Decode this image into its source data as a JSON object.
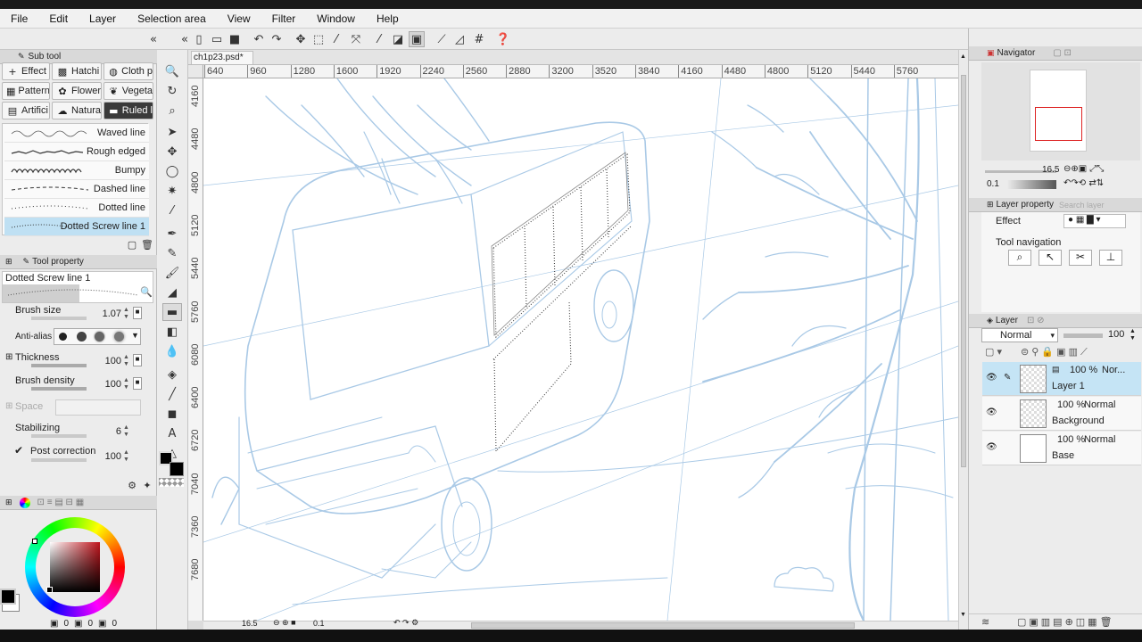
{
  "menu": [
    "File",
    "Edit",
    "Layer",
    "Selection area",
    "View",
    "Filter",
    "Window",
    "Help"
  ],
  "sub_tool": {
    "title": "Sub tool",
    "tabs": [
      {
        "label": "Effect",
        "icon": "plus-icon"
      },
      {
        "label": "Hatchi",
        "icon": "hatching-icon"
      },
      {
        "label": "Cloth p",
        "icon": "cloth-icon"
      },
      {
        "label": "Pattern",
        "icon": "pattern-icon"
      },
      {
        "label": "Flower",
        "icon": "flower-icon"
      },
      {
        "label": "Vegeta",
        "icon": "vegetation-icon"
      },
      {
        "label": "Artifici",
        "icon": "artificial-icon"
      },
      {
        "label": "Natura",
        "icon": "nature-icon"
      },
      {
        "label": "Ruled l",
        "icon": "ruled-line-icon"
      }
    ],
    "brushes": [
      "Waved line",
      "Rough edged",
      "Bumpy",
      "Dashed line",
      "Dotted line",
      "Dotted Screw line 1"
    ],
    "selected_brush": "Dotted Screw line 1"
  },
  "tool_property": {
    "title": "Tool property",
    "brush_name": "Dotted Screw line 1",
    "brush_size_label": "Brush size",
    "brush_size": "1.07",
    "anti_alias_label": "Anti-alias",
    "thickness_label": "Thickness",
    "thickness": "100",
    "brush_density_label": "Brush density",
    "brush_density": "100",
    "space_label": "Space",
    "stabilizing_label": "Stabilizing",
    "stabilizing": "6",
    "post_correction_label": "Post correction",
    "post_correction": "100"
  },
  "color": {
    "main_color": "#000000",
    "sub_color": "#ffffff",
    "hue_base": "#c0141c",
    "counts": [
      "0",
      "0",
      "0"
    ]
  },
  "document": {
    "tab_label": "ch1p23.psd*",
    "h_ruler": [
      "640",
      "960",
      "1280",
      "1600",
      "1920",
      "2240",
      "2560",
      "2880",
      "3200",
      "3520",
      "3840",
      "4160",
      "4480",
      "4800",
      "5120",
      "5440",
      "5760"
    ],
    "v_ruler": [
      "4160",
      "4480",
      "4800",
      "5120",
      "5440",
      "5760",
      "6080",
      "6400",
      "6720",
      "7040",
      "7360",
      "7680"
    ],
    "status_zoom": "16.5",
    "status_angle": "0.1"
  },
  "navigator": {
    "title": "Navigator",
    "zoom": "16.5",
    "angle": "0.1"
  },
  "layer_property": {
    "title": "Layer property",
    "effect_label": "Effect",
    "tool_navigation_label": "Tool navigation",
    "search_label": "Search layer"
  },
  "layer_panel": {
    "title": "Layer",
    "blend_mode": "Normal",
    "opacity": "100",
    "layers": [
      {
        "name": "Layer 1",
        "opacity": "100 %",
        "mode": "Nor...",
        "selected": true
      },
      {
        "name": "Background",
        "opacity": "100 %",
        "mode": "Normal",
        "selected": false
      },
      {
        "name": "Base",
        "opacity": "100 %",
        "mode": "Normal",
        "selected": false
      }
    ]
  },
  "colors": {
    "sketch_blue": "#a9c9e6",
    "selection_blue": "#bfe0f3",
    "panel_bg": "#ececec"
  }
}
